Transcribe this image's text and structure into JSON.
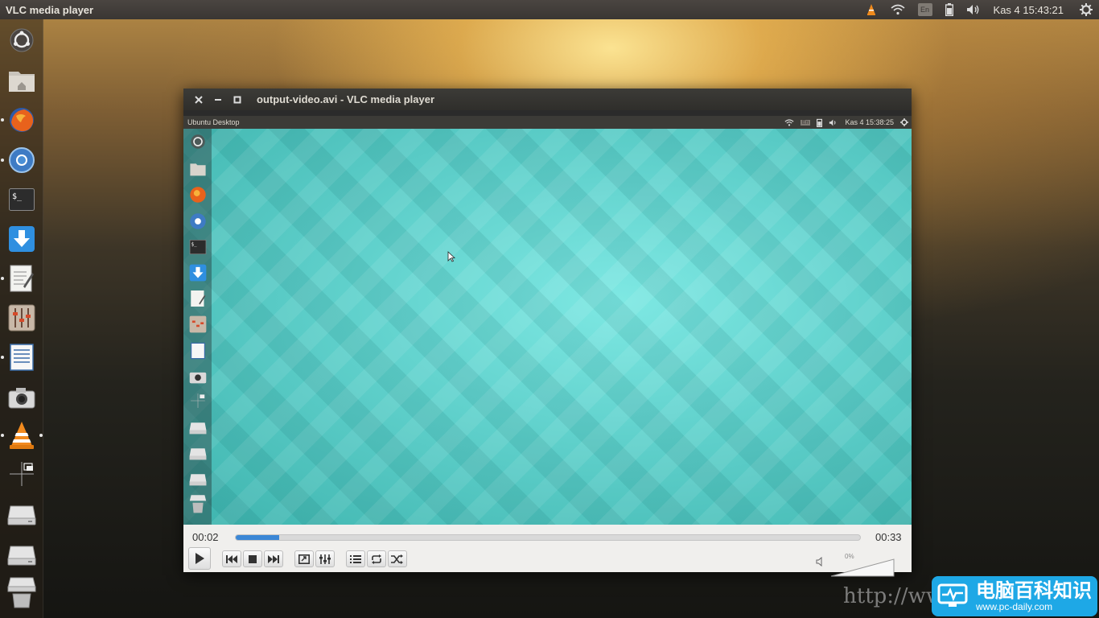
{
  "top_panel": {
    "app_title": "VLC media player",
    "keyboard_indicator": "En",
    "clock": "Kas  4 15:43:21"
  },
  "launcher": {
    "items": [
      "dash-home",
      "files",
      "firefox",
      "chromium",
      "terminal",
      "software-updater",
      "text-editor",
      "system-settings",
      "document-viewer",
      "cheese-camera",
      "vlc",
      "workspace-switcher",
      "drive-1",
      "drive-2",
      "trash"
    ]
  },
  "vlc": {
    "window_title": "output-video.avi - VLC media player",
    "elapsed_time": "00:02",
    "total_time": "00:33",
    "progress": 0.07,
    "volume_label": "0%",
    "volume_level": 0
  },
  "video_frame": {
    "panel_title": "Ubuntu Desktop",
    "keyboard_indicator": "En",
    "clock": "Kas  4 15:38:25"
  },
  "watermark": {
    "url": "http://ww",
    "brand_name": "电脑百科知识",
    "brand_site": "www.pc-daily.com"
  },
  "colors": {
    "accent": "#3b87d6",
    "video_bg": "#5fd0cb",
    "panel": "#3c3b37"
  }
}
